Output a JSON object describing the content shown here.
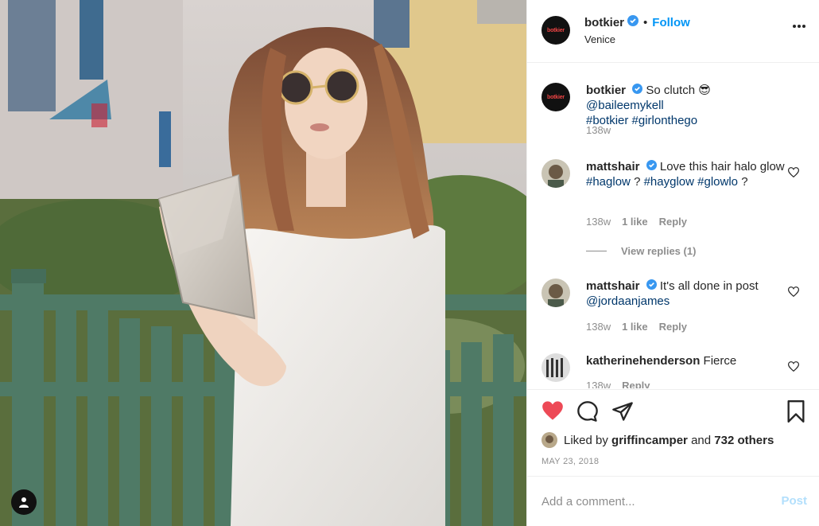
{
  "post": {
    "username": "botkier",
    "follow_label": "Follow",
    "location": "Venice",
    "separator": "•"
  },
  "avatar_logo_text": "botkier",
  "comments": [
    {
      "username": "botkier",
      "text": "So clutch 😎",
      "mention": "@baileemykell",
      "hashtags": "#botkier #girlonthego",
      "time": "138w"
    },
    {
      "username": "mattshair",
      "text": "Love this hair halo glow",
      "tags": [
        "#haglow",
        "?",
        "#hayglow",
        "#glowlo",
        "?"
      ],
      "time": "138w",
      "likes": "1 like",
      "reply": "Reply",
      "view_replies": "View replies (1)"
    },
    {
      "username": "mattshair",
      "text": "It's all done in post",
      "mention": "@jordaanjames",
      "time": "138w",
      "likes": "1 like",
      "reply": "Reply"
    },
    {
      "username": "katherinehenderson",
      "text": "Fierce",
      "time": "138w",
      "reply": "Reply"
    }
  ],
  "likes": {
    "prefix": "Liked by",
    "user": "griffincamper",
    "and": "and",
    "others": "732 others"
  },
  "date": "MAY 23, 2018",
  "comment_input": {
    "placeholder": "Add a comment...",
    "post_label": "Post"
  },
  "colors": {
    "link": "#00376b",
    "follow": "#0095f6",
    "heart": "#ed4956",
    "muted": "#8e8e8e",
    "post_disabled": "#b2dffc"
  },
  "icons": [
    "verified-badge-icon",
    "more-options-icon",
    "heart-icon",
    "comment-icon",
    "share-icon",
    "bookmark-icon",
    "user-tag-icon"
  ]
}
